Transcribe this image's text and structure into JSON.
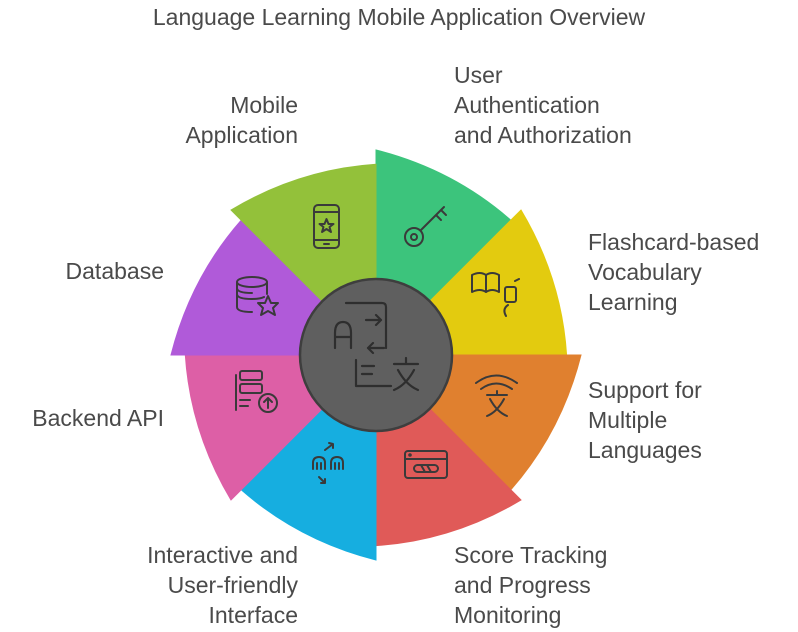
{
  "title": "Language Learning Mobile Application Overview",
  "segments": [
    {
      "id": "user-auth",
      "lines": [
        "User",
        "Authentication",
        "and Authorization"
      ],
      "color": "#3cc47c",
      "icon": "key-icon"
    },
    {
      "id": "flashcards",
      "lines": [
        "Flashcard-based",
        "Vocabulary",
        "Learning"
      ],
      "color": "#e3cb0f",
      "icon": "book-phone-icon"
    },
    {
      "id": "languages",
      "lines": [
        "Support for",
        "Multiple",
        "Languages"
      ],
      "color": "#e0802f",
      "icon": "language-icon"
    },
    {
      "id": "score",
      "lines": [
        "Score Tracking",
        "and Progress",
        "Monitoring"
      ],
      "color": "#e05a58",
      "icon": "progress-card-icon"
    },
    {
      "id": "interface",
      "lines": [
        "Interactive and",
        "User-friendly",
        "Interface"
      ],
      "color": "#16aee0",
      "icon": "users-arrows-icon"
    },
    {
      "id": "backend",
      "lines": [
        "Backend API"
      ],
      "color": "#dd5fa6",
      "icon": "server-upload-icon"
    },
    {
      "id": "database",
      "lines": [
        "Database"
      ],
      "color": "#b05ad9",
      "icon": "database-star-icon"
    },
    {
      "id": "mobile",
      "lines": [
        "Mobile",
        "Application"
      ],
      "color": "#93c13a",
      "icon": "mobile-star-icon"
    }
  ],
  "center": {
    "color": "#5f5f5f",
    "icon": "translate-icon"
  }
}
